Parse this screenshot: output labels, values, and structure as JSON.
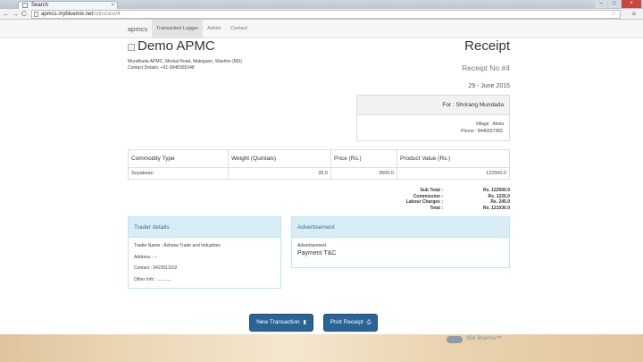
{
  "browser": {
    "tab_title": "Search",
    "url_host": "apmcs.mybluemix.net",
    "url_path": "/u/invoice/4",
    "tab_close": "×",
    "window_buttons": [
      "–",
      "□",
      "×"
    ],
    "nav_back": "←",
    "nav_forward": "→",
    "nav_reload": "C",
    "star_glyph": "☆",
    "menu_glyph": "≡"
  },
  "navbar": {
    "brand": "apmcs",
    "items": [
      "Transaction Logger",
      "Admin",
      "Contact"
    ],
    "active_index": 0
  },
  "header": {
    "company_name": "Demo APMC",
    "address": "Mundhada APMC, Merkal Road, Malegaon, Washim (MS)",
    "contact": "Contact Details: +91-9948365348",
    "receipt_title": "Receipt",
    "receipt_no": "Receipt No #4",
    "date": "29 - June 2015"
  },
  "farmer": {
    "for_label": "For : Shrirang Mundada",
    "village": "Village : Akola",
    "phone": "Phone : 8446557383."
  },
  "table": {
    "headers": [
      "Commodity Type",
      "Weight (Quintals)",
      "Price (Rs.)",
      "Product Value (Rs.)"
    ],
    "rows": [
      [
        "Soyabean",
        "35.0",
        "3500.0",
        "122500.0"
      ]
    ]
  },
  "totals": {
    "subtotal_label": "Sub Total :",
    "subtotal_value": "Rs. 122500.0",
    "commission_label": "Commission :",
    "commission_value": "Rs. 1225.0",
    "labour_label": "Labour Charges :",
    "labour_value": "Rs. 245.0",
    "total_label": "Total :",
    "total_value": "Rs. 121030.0"
  },
  "trader": {
    "heading": "Trader details",
    "name": "Trader Name : Ashoka Trade and Industries",
    "address": "Address : --",
    "contact": "Contact : 9423011152",
    "other": "Other Info : ..........."
  },
  "advert": {
    "heading": "Advertisement",
    "label": "Advertisement",
    "payment_terms": "Payment T&C"
  },
  "actions": {
    "new_transaction": "New Transaction",
    "print_receipt": "Print Receipt",
    "new_icon": "▮",
    "print_icon": "⎙"
  },
  "footer": {
    "brand": "IBM Bluemix™"
  },
  "colors": {
    "primary_button": "#2a6496",
    "panel_heading_bg": "#d9edf7",
    "panel_heading_text": "#31708f"
  }
}
